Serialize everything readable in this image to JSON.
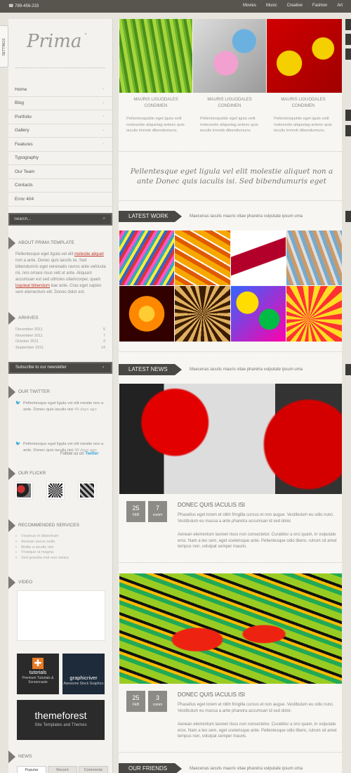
{
  "topbar": {
    "phone": "☎ 789-456-233",
    "nav": [
      "Movies",
      "Music",
      "Creative",
      "Fashion",
      "Art"
    ]
  },
  "settings": "SETTINGS",
  "logo": "Prima",
  "menu": [
    "Home",
    "Blog",
    "Portfolio",
    "Gallery",
    "Features",
    "Typography",
    "Our Team",
    "Contacts",
    "Error 404"
  ],
  "search": {
    "placeholder": "Search..."
  },
  "about": {
    "title": "ABOUT PRIMA TEMPLATE",
    "p1": "Pellentesque eget ligula vel elit ",
    "link1": "molestie aliquet",
    "p2": " non a ante. Donec quis iaculis isi. Sed bibendumris eget venenatis ravros ante vehicula mi, nno ornare risus velt ut ante. Aliquam accumsan est sed ultricies ullamcorper, quam ",
    "link2": "loquleat bibendum",
    "p3": " itae ante. Cras eget sapien sem elementum elit. Donec dolor est."
  },
  "archives": {
    "title": "ARHIVES",
    "rows": [
      {
        "m": "December 2011",
        "c": "5"
      },
      {
        "m": "November 2011",
        "c": "7"
      },
      {
        "m": "October 2011",
        "c": "2"
      },
      {
        "m": "September 2011",
        "c": "14"
      }
    ]
  },
  "newsletter": "Subscribe to our newsletter",
  "twitter": {
    "title": "OUR TWITTER",
    "tweets": [
      {
        "text": "Pellentesque eget ligula vel elit mestie non a ante. Donec quis iaculis nisi ",
        "ago": "49 days ago"
      },
      {
        "text": "Pellentesque eget ligula vel elit mestie non a ante. Donec quis iaculis nisi ",
        "ago": "49 days ago"
      }
    ],
    "follow": "Follow us on ",
    "follow_link": "Twitter"
  },
  "flickr": {
    "title": "OUR FLICKR"
  },
  "services": {
    "title": "RECOMMENDED SERVICES",
    "items": [
      "Vivamus in bibenhum",
      "Aenean purus nulla",
      "Mollis a iaculis nisi",
      "Tristique ut magna",
      "Sed gravida mol non metus"
    ]
  },
  "video": {
    "title": "VIDEO"
  },
  "ads": {
    "tutorials": "tutorials",
    "tutorials_sub": "Premium Tutorials & Screencasts",
    "graphicriver": "graphicriver",
    "graphicriver_sub": "Awesome Stock Graphics",
    "themeforest": "themeforest",
    "themeforest_sub": "Site Templates and Themes"
  },
  "news": {
    "title": "NEWS",
    "tabs": [
      "Popular",
      "Recent",
      "Comments"
    ]
  },
  "columns": [
    {
      "cap": "MAURIS LIGUODALES CONDIMEN",
      "txt": "Pellentesqudde eget igula velit molessrtie aliquetag anteec quis iaculis immob dibendumuns."
    },
    {
      "cap": "MAURIS LIGUODALES CONDIMEN",
      "txt": "Pellentesqudde eget igula velit molessrtie aliquetag anteec quis iaculis immob dibendumuns."
    },
    {
      "cap": "MAURIS LIGUODALES CONDIMEN",
      "txt": "Pellentesqudde eget igula velit molessrtie aliquetag anteec quis iaculis immob dibendumuns."
    }
  ],
  "quote": "Pellentesque eget ligula vel elit molestie aliquet non a ante Donec quis iaculis isi. Sed bibendumuris eget",
  "latest_work": {
    "title": "LATEST WORK",
    "tagline": "Maecenas iaculis mauris vitae pharetra vulputate ipsum uma"
  },
  "latest_news": {
    "title": "LATEST NEWS",
    "tagline": "Maecenas iaculis mauris vitae pharetra vulputate ipsum uma"
  },
  "posts": [
    {
      "day": "25",
      "month": "FEB",
      "comments": "7",
      "comments_label": "comm",
      "title": "DONEC QUIS IACULIS ISI",
      "p1": "Phasellus eget lorem et nibh fringilla cursus et non augue. Vestibulum eu odio nunc. Vestibulum eu massa a ante pharetra accumsan id sed dolor.",
      "p2": "Aenean elementum laoreet risus non consectetur. Curabitur a orci quam, in vulputate eros. Nam a leo sem, eget scelerisque ante. Pellentesque odio libero, rutrum sit amet tempus non, volutpat semper mauris."
    },
    {
      "day": "25",
      "month": "FEB",
      "comments": "3",
      "comments_label": "comm",
      "title": "DONEC QUIS IACULIS ISI",
      "p1": "Phasellus eget lorem et nibh fringilla cursus et non augue. Vestibulum eu odio nunc. Vestibulum eu massa a ante pharetra accumsan id sed dolor.",
      "p2": "Aenean elementum laoreet risus non consectetur. Curabitur a orci quam, in vulputate eros. Nam a leo sem, eget scelerisque ante. Pellentesque odio libero, rutrum sit amet tempus non, volutpat semper mauris."
    }
  ],
  "our_friends": {
    "title": "OUR FRIENDS",
    "tagline": "Maecenas iaculis mauris vitae pharetra vulputate ipsum uma"
  },
  "colors": {
    "topbar": "#58554e",
    "banner": "#4a4845",
    "link": "#c0392b",
    "twitter_link": "#3aa7d8"
  }
}
